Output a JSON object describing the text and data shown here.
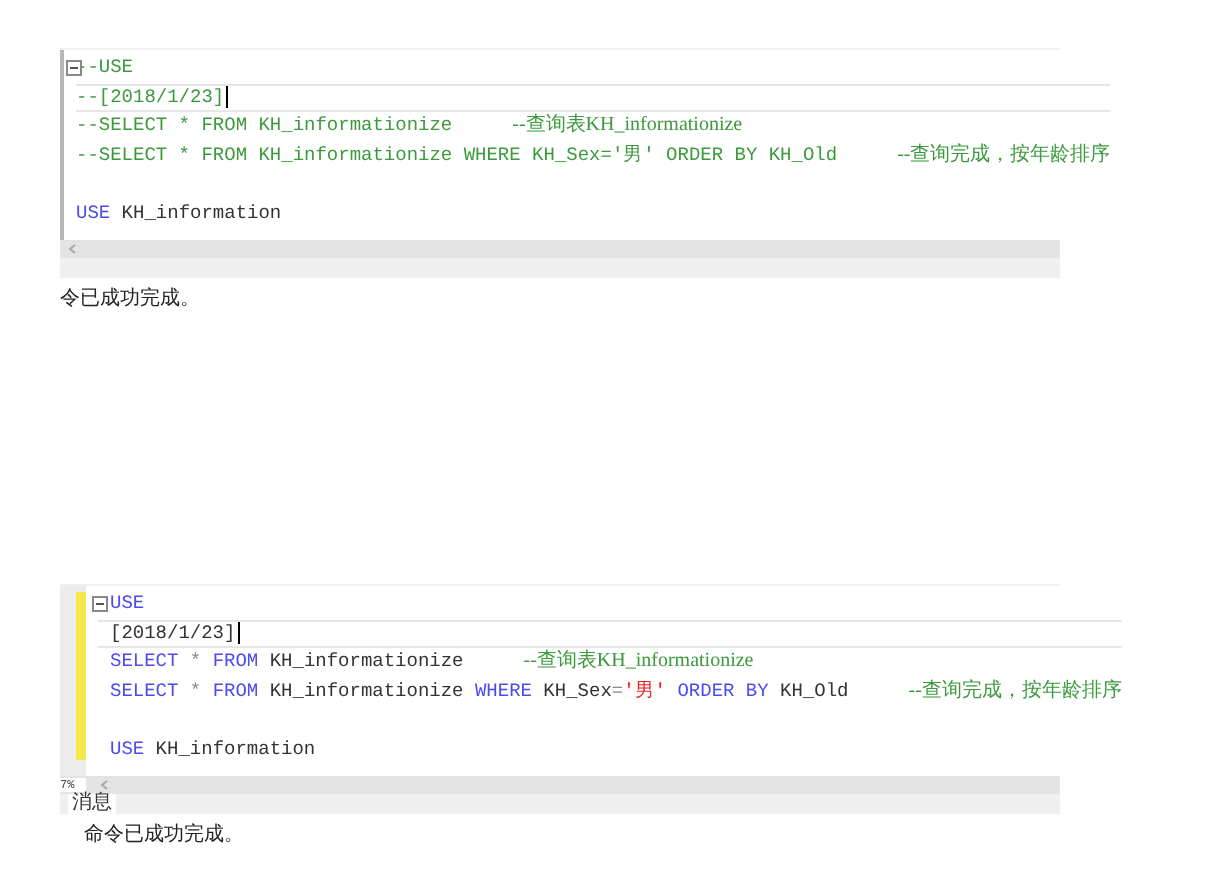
{
  "panels": [
    {
      "change_bar": false,
      "lines": [
        {
          "kind": "code",
          "fold": true,
          "tokens": [
            {
              "text": "--USE",
              "kind": "comment"
            }
          ]
        },
        {
          "kind": "code",
          "cursor": true,
          "tokens": [
            {
              "text": "--[2018/1/23]",
              "kind": "comment"
            }
          ]
        },
        {
          "kind": "code",
          "tokens": [
            {
              "text": "--SELECT * FROM KH_informationize",
              "kind": "comment"
            }
          ],
          "note": "--查询表KH_informationize"
        },
        {
          "kind": "code",
          "tokens": [
            {
              "text": "--SELECT * FROM KH_informationize WHERE KH_Sex='男' ORDER BY KH_Old",
              "kind": "comment"
            }
          ],
          "note": "--查询完成，按年龄排序"
        },
        {
          "kind": "blank"
        },
        {
          "kind": "code",
          "tokens": [
            {
              "text": "USE",
              "kind": "keyword"
            },
            {
              "text": " KH_information",
              "kind": "plain"
            }
          ]
        }
      ],
      "message": "令已成功完成。"
    },
    {
      "change_bar": true,
      "lines": [
        {
          "kind": "code",
          "fold": true,
          "tokens": [
            {
              "text": "USE",
              "kind": "keyword"
            }
          ]
        },
        {
          "kind": "code",
          "cursor": true,
          "tokens": [
            {
              "text": "[2018/1/23]",
              "kind": "plain"
            }
          ]
        },
        {
          "kind": "code",
          "tokens": [
            {
              "text": "SELECT",
              "kind": "keyword"
            },
            {
              "text": " *",
              "kind": "operator"
            },
            {
              "text": " FROM",
              "kind": "keyword"
            },
            {
              "text": " KH_informationize",
              "kind": "plain"
            }
          ],
          "note": "--查询表KH_informationize"
        },
        {
          "kind": "code",
          "tokens": [
            {
              "text": "SELECT",
              "kind": "keyword"
            },
            {
              "text": " *",
              "kind": "operator"
            },
            {
              "text": " FROM",
              "kind": "keyword"
            },
            {
              "text": " KH_informationize",
              "kind": "plain"
            },
            {
              "text": " WHERE",
              "kind": "keyword"
            },
            {
              "text": " KH_Sex",
              "kind": "plain"
            },
            {
              "text": "=",
              "kind": "operator"
            },
            {
              "text": "'男'",
              "kind": "string"
            },
            {
              "text": " ORDER BY",
              "kind": "keyword"
            },
            {
              "text": " KH_Old",
              "kind": "plain"
            }
          ],
          "note": "--查询完成，按年龄排序"
        },
        {
          "kind": "blank"
        },
        {
          "kind": "code",
          "tokens": [
            {
              "text": "USE",
              "kind": "keyword"
            },
            {
              "text": " KH_information",
              "kind": "plain"
            }
          ]
        }
      ],
      "zoom": "7%",
      "tab": "消息",
      "message": "命令已成功完成。"
    }
  ]
}
